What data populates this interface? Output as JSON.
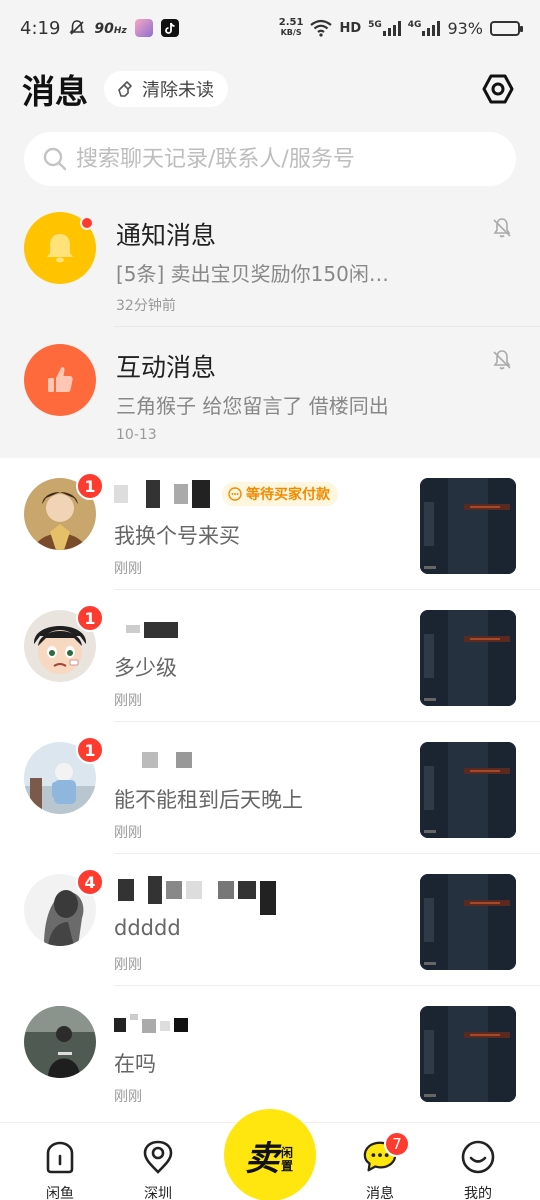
{
  "status_bar": {
    "time": "4:19",
    "refresh_rate": "90",
    "refresh_unit": "Hz",
    "net_speed_value": "2.51",
    "net_speed_unit": "KB/S",
    "hd_label": "HD",
    "sim1_label": "5G",
    "sim2_label": "4G",
    "battery": "93%",
    "battery_level": 0.93
  },
  "header": {
    "title": "消息",
    "clear_unread_label": "清除未读"
  },
  "search": {
    "placeholder": "搜索聊天记录/联系人/服务号"
  },
  "system_messages": [
    {
      "title": "通知消息",
      "preview": "[5条] 卖出宝贝奖励你150闲…",
      "time": "32分钟前",
      "icon": "bell-icon",
      "color": "#ffc300",
      "has_dot": true
    },
    {
      "title": "互动消息",
      "preview": "三角猴子 给您留言了 借楼同出",
      "time": "10-13",
      "icon": "thumbs-up-icon",
      "color": "#ff6a3d",
      "has_dot": false
    }
  ],
  "chats": [
    {
      "badge": "1",
      "tag": "等待买家付款",
      "preview": "我换个号来买",
      "time": "刚刚"
    },
    {
      "badge": "1",
      "tag": "",
      "preview": "多少级",
      "time": "刚刚"
    },
    {
      "badge": "1",
      "tag": "",
      "preview": "能不能租到后天晚上",
      "time": "刚刚"
    },
    {
      "badge": "4",
      "tag": "",
      "preview": "ddddd",
      "time": "刚刚"
    },
    {
      "badge": "",
      "tag": "",
      "preview": "在吗",
      "time": "刚刚"
    }
  ],
  "bottom_nav": {
    "items": [
      {
        "label": "闲鱼",
        "icon": "home-icon"
      },
      {
        "label": "深圳",
        "icon": "location-icon"
      },
      {
        "label": "消息",
        "icon": "chat-icon",
        "badge": "7"
      },
      {
        "label": "我的",
        "icon": "smiley-icon"
      }
    ],
    "sell_main": "卖",
    "sell_sub": "闲置"
  },
  "colors": {
    "accent_yellow": "#ffe60f",
    "badge_red": "#ff3b30",
    "tag_orange": "#f08c00"
  }
}
